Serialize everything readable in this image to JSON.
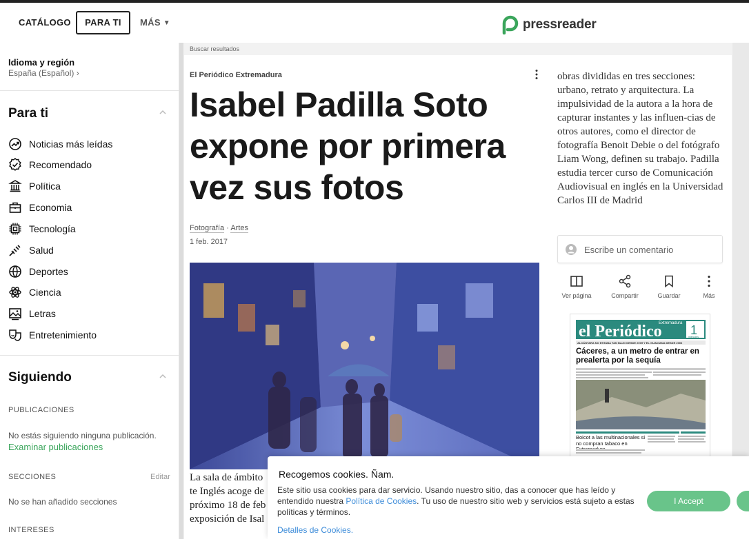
{
  "header": {
    "nav": {
      "catalog": "CATÁLOGO",
      "for_you": "PARA TI",
      "more": "MÁS"
    },
    "logo_text": "pressreader",
    "brand_color": "#3aa55b"
  },
  "sidebar": {
    "region": {
      "title": "Idioma y región",
      "value": "España (Español) ›"
    },
    "para_ti": {
      "title": "Para ti",
      "items": [
        {
          "label": "Noticias más leídas",
          "icon": "trending-icon"
        },
        {
          "label": "Recomendado",
          "icon": "check-badge-icon"
        },
        {
          "label": "Política",
          "icon": "government-icon"
        },
        {
          "label": "Economia",
          "icon": "briefcase-icon"
        },
        {
          "label": "Tecnología",
          "icon": "chip-icon"
        },
        {
          "label": "Salud",
          "icon": "health-icon"
        },
        {
          "label": "Deportes",
          "icon": "ball-icon"
        },
        {
          "label": "Ciencia",
          "icon": "atom-icon"
        },
        {
          "label": "Letras",
          "icon": "picture-icon"
        },
        {
          "label": "Entretenimiento",
          "icon": "masks-icon"
        }
      ]
    },
    "siguiendo": {
      "title": "Siguiendo",
      "publications_label": "PUBLICACIONES",
      "publications_empty": "No estás siguiendo ninguna publicación.",
      "browse_link": "Examinar publicaciones",
      "sections_label": "SECCIONES",
      "edit_label": "Editar",
      "sections_empty": "No se han añadido secciones",
      "interests_label": "INTERESES"
    }
  },
  "article": {
    "search_results": "Buscar resultados",
    "publication": "El Periódico Extremadura",
    "headline": "Isabel Padilla Soto expone por primera vez sus fotos",
    "tags": [
      "Fotografía",
      "Artes"
    ],
    "tag_separator": "·",
    "date": "1 feb. 2017",
    "caption_lines": [
      "La sala de ámbito",
      "te Inglés acoge de",
      "próximo 18 de feb",
      "exposición de Isal"
    ],
    "body": "obras divididas en tres secciones: urbano, retrato y arquitectura. La impulsividad de la autora a la hora de capturar instantes y las influen-cias de otros autores, como el director de fotografía Benoit Debie o del fotógrafo Liam Wong, definen su trabajo. Padilla estudia tercer curso de Comunicación Audiovisual en inglés en la Universidad Carlos III de Madrid",
    "comment_placeholder": "Escribe un comentario",
    "actions": {
      "view_page": "Ver página",
      "share": "Compartir",
      "save": "Guardar",
      "more": "Más"
    }
  },
  "thumbnail": {
    "masthead": "el Periódico",
    "edition": "Extremadura",
    "day": "1",
    "weekday": "miércoles",
    "kicker": "ALCÁNTARA NO ESTABA TAN BAJO DESDE 2009 Y EL GUADIANA DESDE 2006",
    "headline": "Cáceres, a un metro de entrar en prealerta por la sequía",
    "sub_headline": "Boicot a las multinacionales si no compran tabaco en Extremadura"
  },
  "cookie": {
    "title": "Recogemos cookies. Ñam.",
    "text_before": "Este sitio usa cookies para dar servicio. Usando nuestro sitio, das a conocer que has leído y entendido nuestra ",
    "policy_link": "Política de Cookies",
    "text_after": ". Tu uso de nuestro sitio web y servicios está sujeto a estas políticas y términos.",
    "details_link": "Detalles de Cookies.",
    "accept": "I Accept"
  }
}
